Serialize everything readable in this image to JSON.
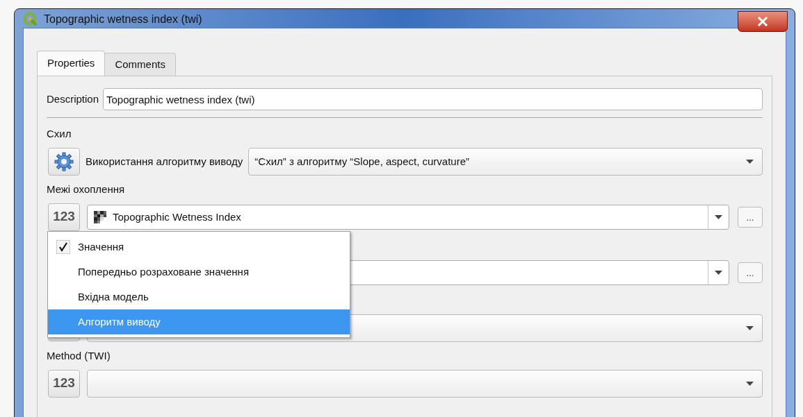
{
  "window": {
    "title": "Topographic wetness index (twi)"
  },
  "tabs": [
    {
      "label": "Properties",
      "selected": true
    },
    {
      "label": "Comments",
      "selected": false
    }
  ],
  "description": {
    "label": "Description",
    "value": "Topographic wetness index (twi)"
  },
  "parameters": [
    {
      "label": "Схил",
      "kind": "algorithm",
      "source_label": "Використання алгоритму виводу",
      "value": "“Схил” з алгоритму “Slope, aspect, curvature”"
    },
    {
      "label": "Межі охоплення",
      "kind": "layer",
      "button_label": "123",
      "value": "Topographic Wetness Index",
      "browse_label": "..."
    },
    {
      "kind": "layer",
      "browse_label": "..."
    },
    {
      "kind": "enum"
    },
    {
      "label": "Method (TWI)",
      "kind": "enum",
      "button_label": "123"
    }
  ],
  "source_menu": {
    "items": [
      {
        "label": "Значення",
        "checked": true,
        "selected": false
      },
      {
        "label": "Попередньо розраховане значення",
        "checked": false,
        "selected": false
      },
      {
        "label": "Вхідна модель",
        "checked": false,
        "selected": false
      },
      {
        "label": "Алгоритм виводу",
        "checked": false,
        "selected": true
      }
    ]
  }
}
